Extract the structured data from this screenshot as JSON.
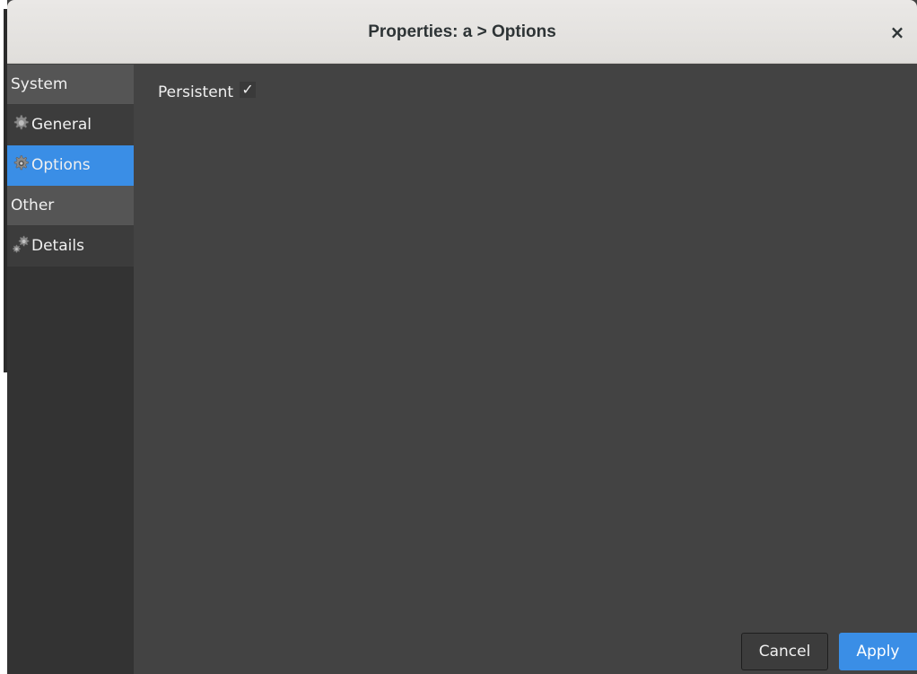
{
  "window": {
    "title": "Properties: a > Options",
    "close_glyph": "×"
  },
  "sidebar": {
    "items": [
      {
        "type": "header",
        "label": "System"
      },
      {
        "type": "entry",
        "label": "General",
        "icon": "gear-icon",
        "selected": false
      },
      {
        "type": "entry",
        "label": "Options",
        "icon": "gear-icon",
        "selected": true
      },
      {
        "type": "header",
        "label": "Other"
      },
      {
        "type": "entry",
        "label": "Details",
        "icon": "gears-icon",
        "selected": false
      }
    ]
  },
  "content": {
    "persistent_label": "Persistent",
    "persistent_checked": true,
    "check_glyph": "✓"
  },
  "buttons": {
    "cancel_label": "Cancel",
    "apply_label": "Apply"
  },
  "colors": {
    "accent": "#3a8ee6",
    "content_bg": "#434343",
    "sidebar_bg": "#333333",
    "titlebar_bg": "#e6e4e1"
  }
}
